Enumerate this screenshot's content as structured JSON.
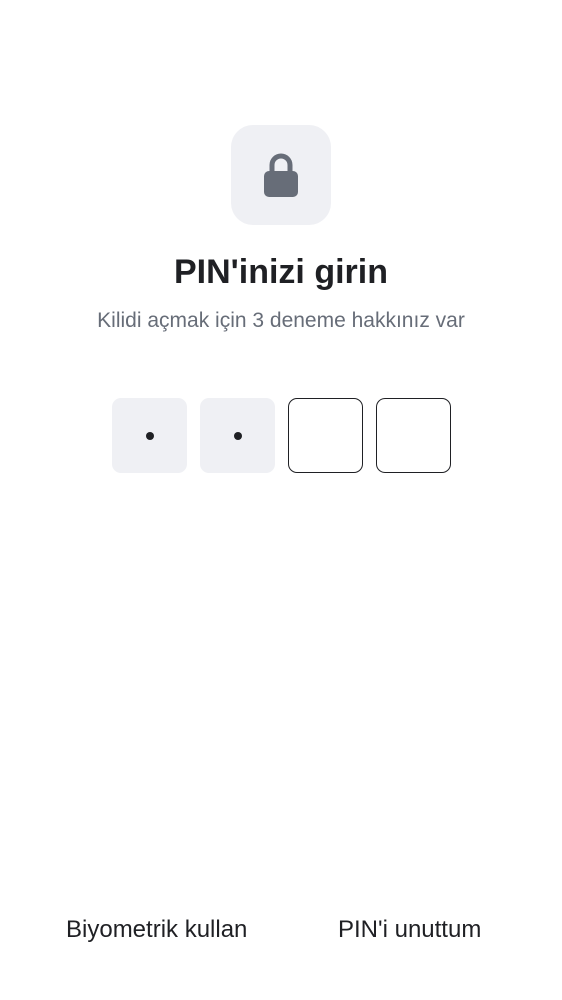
{
  "header": {
    "icon": "lock-icon",
    "title": "PIN'inizi girin",
    "subtitle": "Kilidi açmak için 3 deneme hakkınız var"
  },
  "pin": {
    "length": 4,
    "entered": 2
  },
  "actions": {
    "biometric_label": "Biyometrik kullan",
    "forgot_label": "PIN'i unuttum"
  },
  "colors": {
    "tile_background": "#eff0f4",
    "icon": "#676d78",
    "text_primary": "#1f2024",
    "text_secondary": "#676d78"
  }
}
